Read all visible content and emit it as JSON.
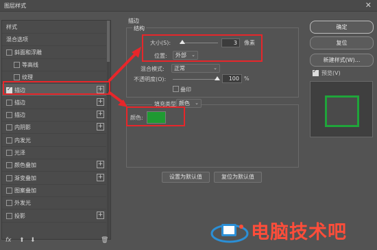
{
  "window": {
    "title": "图层样式",
    "close_glyph": "✕"
  },
  "left_panel": {
    "items": [
      {
        "label": "样式",
        "checkbox": false,
        "checked": false,
        "plus": false,
        "indent": 0
      },
      {
        "label": "混合选项",
        "checkbox": false,
        "checked": false,
        "plus": false,
        "indent": 0
      },
      {
        "label": "斜面和浮雕",
        "checkbox": true,
        "checked": false,
        "plus": false,
        "indent": 0
      },
      {
        "label": "等高线",
        "checkbox": true,
        "checked": false,
        "plus": false,
        "indent": 1
      },
      {
        "label": "纹理",
        "checkbox": true,
        "checked": false,
        "plus": false,
        "indent": 1
      },
      {
        "label": "描边",
        "checkbox": true,
        "checked": true,
        "plus": true,
        "indent": 0,
        "selected": true
      },
      {
        "label": "描边",
        "checkbox": true,
        "checked": false,
        "plus": true,
        "indent": 0
      },
      {
        "label": "描边",
        "checkbox": true,
        "checked": false,
        "plus": true,
        "indent": 0
      },
      {
        "label": "内阴影",
        "checkbox": true,
        "checked": false,
        "plus": true,
        "indent": 0
      },
      {
        "label": "内发光",
        "checkbox": true,
        "checked": false,
        "plus": false,
        "indent": 0
      },
      {
        "label": "光泽",
        "checkbox": true,
        "checked": false,
        "plus": false,
        "indent": 0
      },
      {
        "label": "颜色叠加",
        "checkbox": true,
        "checked": false,
        "plus": true,
        "indent": 0
      },
      {
        "label": "渐变叠加",
        "checkbox": true,
        "checked": false,
        "plus": true,
        "indent": 0
      },
      {
        "label": "图案叠加",
        "checkbox": true,
        "checked": false,
        "plus": false,
        "indent": 0
      },
      {
        "label": "外发光",
        "checkbox": true,
        "checked": false,
        "plus": false,
        "indent": 0
      },
      {
        "label": "投影",
        "checkbox": true,
        "checked": false,
        "plus": true,
        "indent": 0
      }
    ],
    "bottom": {
      "fx": "fx",
      "up": "⬆",
      "down": "⬇",
      "trash": "🗑"
    }
  },
  "stroke": {
    "section_title": "描边",
    "structure_title": "结构",
    "size_label": "大小(S):",
    "size_value": "3",
    "size_unit": "像素",
    "position_label": "位置:",
    "position_value": "外部",
    "blend_label": "混合模式:",
    "blend_value": "正常",
    "opacity_label": "不透明度(O):",
    "opacity_value": "100",
    "opacity_unit": "%",
    "overprint_label": "叠印",
    "fill_type_label": "填充类型:",
    "fill_type_value": "颜色",
    "color_label": "颜色:",
    "color_value": "#1f9a32",
    "set_default": "设置为默认值",
    "reset_default": "复位为默认值"
  },
  "right_panel": {
    "ok": "确定",
    "reset": "复位",
    "new_style": "新建样式(W)...",
    "preview_label": "预览(V)",
    "preview_checked": true,
    "preview_stroke_color": "#1fa53a"
  },
  "annotations": {
    "color": "#e8262a"
  },
  "watermark": {
    "text": "电脑技术吧"
  }
}
